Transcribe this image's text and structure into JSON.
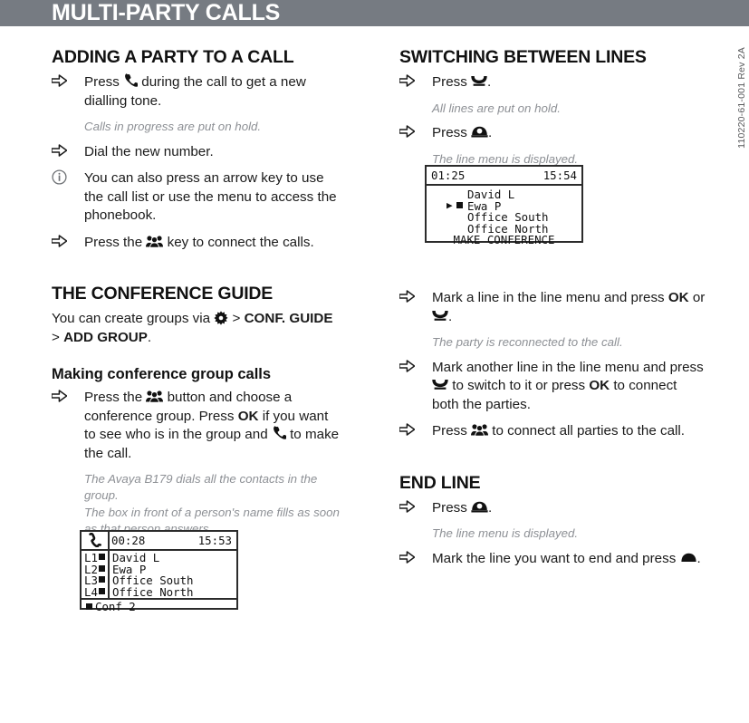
{
  "header": {
    "title": "MULTI-PARTY CALLS",
    "bar_color": "#767b82",
    "text_color": "#ffffff"
  },
  "side_code": "110220-61-001 Rev 2A",
  "left_column": {
    "section1": {
      "heading": "ADDING A PARTY TO A CALL",
      "steps": [
        {
          "marker": "arrow-icon",
          "parts": [
            {
              "t": "text",
              "v": "Press "
            },
            {
              "t": "icon",
              "v": "phone-handset-icon"
            },
            {
              "t": "text",
              "v": " during the call to get a new dialling tone."
            }
          ]
        }
      ],
      "note1": "Calls in progress are put on hold.",
      "step2": "Dial the new number.",
      "info_step": "You can also press an arrow key to use the call list or use the menu to access the phonebook.",
      "step3_pre": "Press the ",
      "step3_post": " key to connect the calls."
    },
    "section2": {
      "heading": "THE CONFERENCE GUIDE",
      "para_pre": "You can create groups via ",
      "para_gt1": " > ",
      "para_b1": "CONF. GUIDE",
      "para_gt2": " > ",
      "para_b2": "ADD GROUP",
      "para_end": ".",
      "subheading": "Making conference group calls",
      "step_p1": "Press the ",
      "step_p2": " button and choose a conference group. Press ",
      "step_ok": "OK",
      "step_p3": " if you want to see who is in the group and ",
      "step_p4": " to make the call.",
      "note1": "The Avaya B179 dials all the contacts in the group.",
      "note2": "The box in front of a person's name fills as soon as that person answers."
    },
    "lcd": {
      "timer": "00:28",
      "clock": "15:53",
      "rows": [
        {
          "label": "L1",
          "name": "David L",
          "filled": true
        },
        {
          "label": "L2",
          "name": "Ewa P",
          "filled": true
        },
        {
          "label": "L3",
          "name": "Office South",
          "filled": true
        },
        {
          "label": "L4",
          "name": "Office North",
          "filled": true
        }
      ],
      "bottom": "Conf 2",
      "handset_icon": "phone-handset-icon"
    }
  },
  "right_column": {
    "section1": {
      "heading": "SWITCHING BETWEEN LINES",
      "step1_pre": "Press ",
      "step1_post": ".",
      "note1": "All lines are put on hold.",
      "step2_pre": "Press ",
      "step2_post": ".",
      "note2": "The line menu is displayed."
    },
    "lcd": {
      "timer": "01:25",
      "clock": "15:54",
      "rows": [
        {
          "name": "David L",
          "marked": false
        },
        {
          "name": "Ewa P",
          "marked": true
        },
        {
          "name": "Office South",
          "marked": false
        },
        {
          "name": "Office North",
          "marked": false
        }
      ],
      "bottom": "MAKE CONFERENCE"
    },
    "section2": {
      "step1_p1": "Mark a line in the line menu and press ",
      "step1_ok": "OK",
      "step1_p2": " or ",
      "step1_p3": ".",
      "note1": "The party is reconnected to the call.",
      "step2_p1": "Mark another line in the line menu and press ",
      "step2_p2": " to switch to it or press ",
      "step2_ok": "OK",
      "step2_p3": " to connect both the parties.",
      "step3_p1": "Press ",
      "step3_p2": " to connect all parties to the call."
    },
    "section3": {
      "heading": "END LINE",
      "step1_pre": "Press ",
      "step1_post": ".",
      "note1": "The line menu is displayed.",
      "step2_pre": "Mark the line you want to end and press ",
      "step2_post": "."
    }
  }
}
